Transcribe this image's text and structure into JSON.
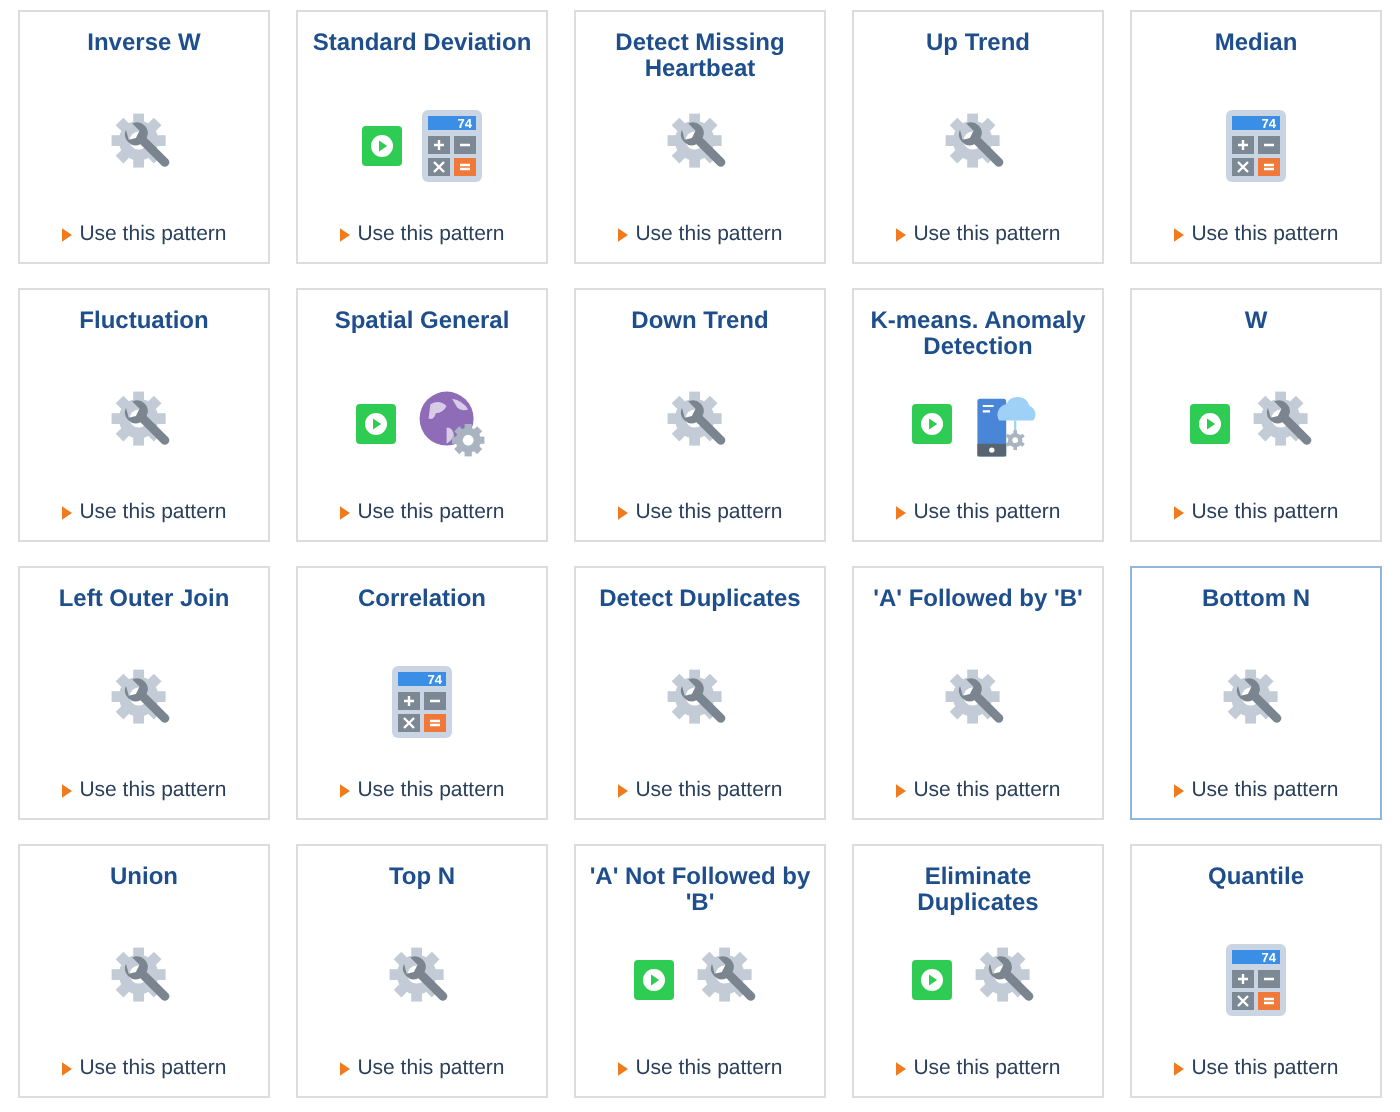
{
  "patterns": [
    {
      "title": "Inverse W",
      "kind": "wrench",
      "video": false,
      "selected": false,
      "link": "Use this pattern"
    },
    {
      "title": "Standard Deviation",
      "kind": "calculator",
      "video": true,
      "selected": false,
      "link": "Use this pattern",
      "calc_display": "74"
    },
    {
      "title": "Detect Missing Heartbeat",
      "kind": "wrench",
      "video": false,
      "selected": false,
      "link": "Use this pattern"
    },
    {
      "title": "Up Trend",
      "kind": "wrench",
      "video": false,
      "selected": false,
      "link": "Use this pattern"
    },
    {
      "title": "Median",
      "kind": "calculator",
      "video": false,
      "selected": false,
      "link": "Use this pattern",
      "calc_display": "74"
    },
    {
      "title": "Fluctuation",
      "kind": "wrench",
      "video": false,
      "selected": false,
      "link": "Use this pattern"
    },
    {
      "title": "Spatial General",
      "kind": "globe",
      "video": true,
      "selected": false,
      "link": "Use this pattern"
    },
    {
      "title": "Down Trend",
      "kind": "wrench",
      "video": false,
      "selected": false,
      "link": "Use this pattern"
    },
    {
      "title": "K-means. Anomaly Detection",
      "kind": "device",
      "video": true,
      "selected": false,
      "link": "Use this pattern"
    },
    {
      "title": "W",
      "kind": "wrench",
      "video": true,
      "selected": false,
      "link": "Use this pattern"
    },
    {
      "title": "Left Outer Join",
      "kind": "wrench",
      "video": false,
      "selected": false,
      "link": "Use this pattern"
    },
    {
      "title": "Correlation",
      "kind": "calculator",
      "video": false,
      "selected": false,
      "link": "Use this pattern",
      "calc_display": "74"
    },
    {
      "title": "Detect Duplicates",
      "kind": "wrench",
      "video": false,
      "selected": false,
      "link": "Use this pattern"
    },
    {
      "title": "'A' Followed by 'B'",
      "kind": "wrench",
      "video": false,
      "selected": false,
      "link": "Use this pattern"
    },
    {
      "title": "Bottom N",
      "kind": "wrench",
      "video": false,
      "selected": true,
      "link": "Use this pattern"
    },
    {
      "title": "Union",
      "kind": "wrench",
      "video": false,
      "selected": false,
      "link": "Use this pattern"
    },
    {
      "title": "Top N",
      "kind": "wrench",
      "video": false,
      "selected": false,
      "link": "Use this pattern"
    },
    {
      "title": "'A' Not Followed by 'B'",
      "kind": "wrench",
      "video": true,
      "selected": false,
      "link": "Use this pattern"
    },
    {
      "title": "Eliminate Duplicates",
      "kind": "wrench",
      "video": true,
      "selected": false,
      "link": "Use this pattern"
    },
    {
      "title": "Quantile",
      "kind": "calculator",
      "video": false,
      "selected": false,
      "link": "Use this pattern",
      "calc_display": "74"
    }
  ]
}
